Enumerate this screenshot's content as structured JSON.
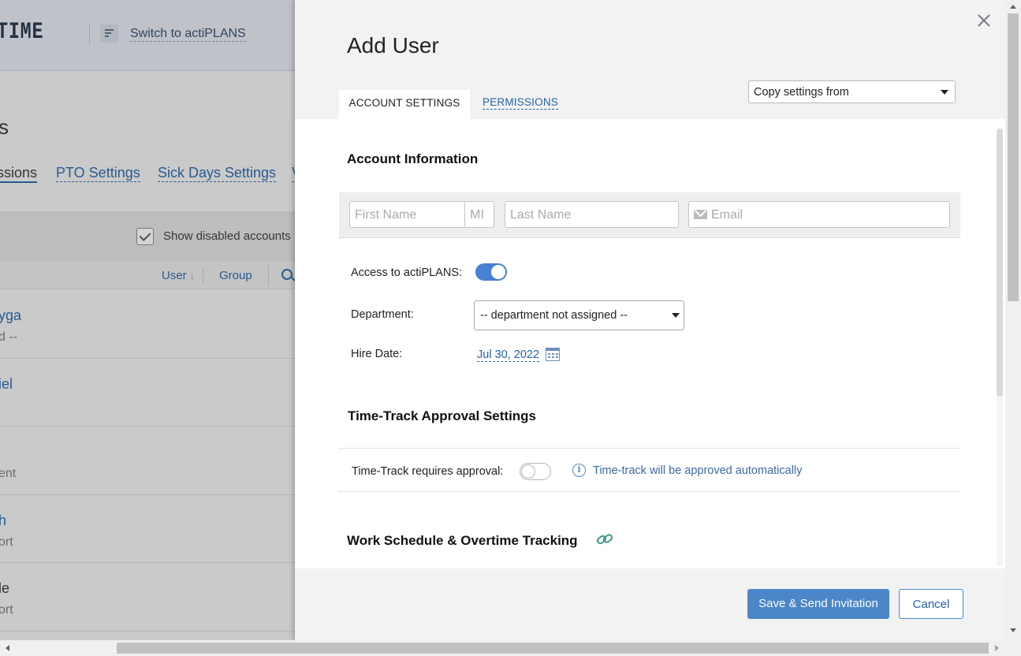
{
  "background": {
    "logo_text": "TIME",
    "switch_link": "Switch to actiPLANS",
    "title_fragment": "s",
    "tabs": [
      "ssions",
      "PTO Settings",
      "Sick Days Settings",
      "V"
    ],
    "show_disabled_label": "Show disabled accounts",
    "columns": {
      "user": "User",
      "group": "Group"
    },
    "rows": [
      {
        "name": "yga",
        "sub": "d --"
      },
      {
        "name": "iel",
        "sub": ""
      },
      {
        "name": "",
        "sub": "ent"
      },
      {
        "name": "h",
        "sub": "ort"
      },
      {
        "name": "le",
        "sub": "ort"
      }
    ]
  },
  "panel": {
    "title": "Add User",
    "tabs": {
      "account": "ACCOUNT SETTINGS",
      "permissions": "PERMISSIONS"
    },
    "copy_settings": "Copy settings from",
    "account_info": {
      "heading": "Account Information",
      "first_name_placeholder": "First Name",
      "mi_placeholder": "MI",
      "last_name_placeholder": "Last Name",
      "email_placeholder": "Email"
    },
    "access_label": "Access to actiPLANS:",
    "access_enabled": true,
    "department_label": "Department:",
    "department_value": "-- department not assigned --",
    "hire_date_label": "Hire Date:",
    "hire_date_value": "Jul 30, 2022",
    "time_track": {
      "heading": "Time-Track Approval Settings",
      "requires_label": "Time-Track requires approval:",
      "requires_enabled": false,
      "info_text": "Time-track will be approved automatically"
    },
    "work_schedule_heading": "Work Schedule & Overtime Tracking",
    "buttons": {
      "save": "Save & Send Invitation",
      "cancel": "Cancel"
    }
  },
  "colors": {
    "accent": "#4b86c8",
    "link": "#2563a9",
    "toggle_on": "#4a7fd3"
  }
}
